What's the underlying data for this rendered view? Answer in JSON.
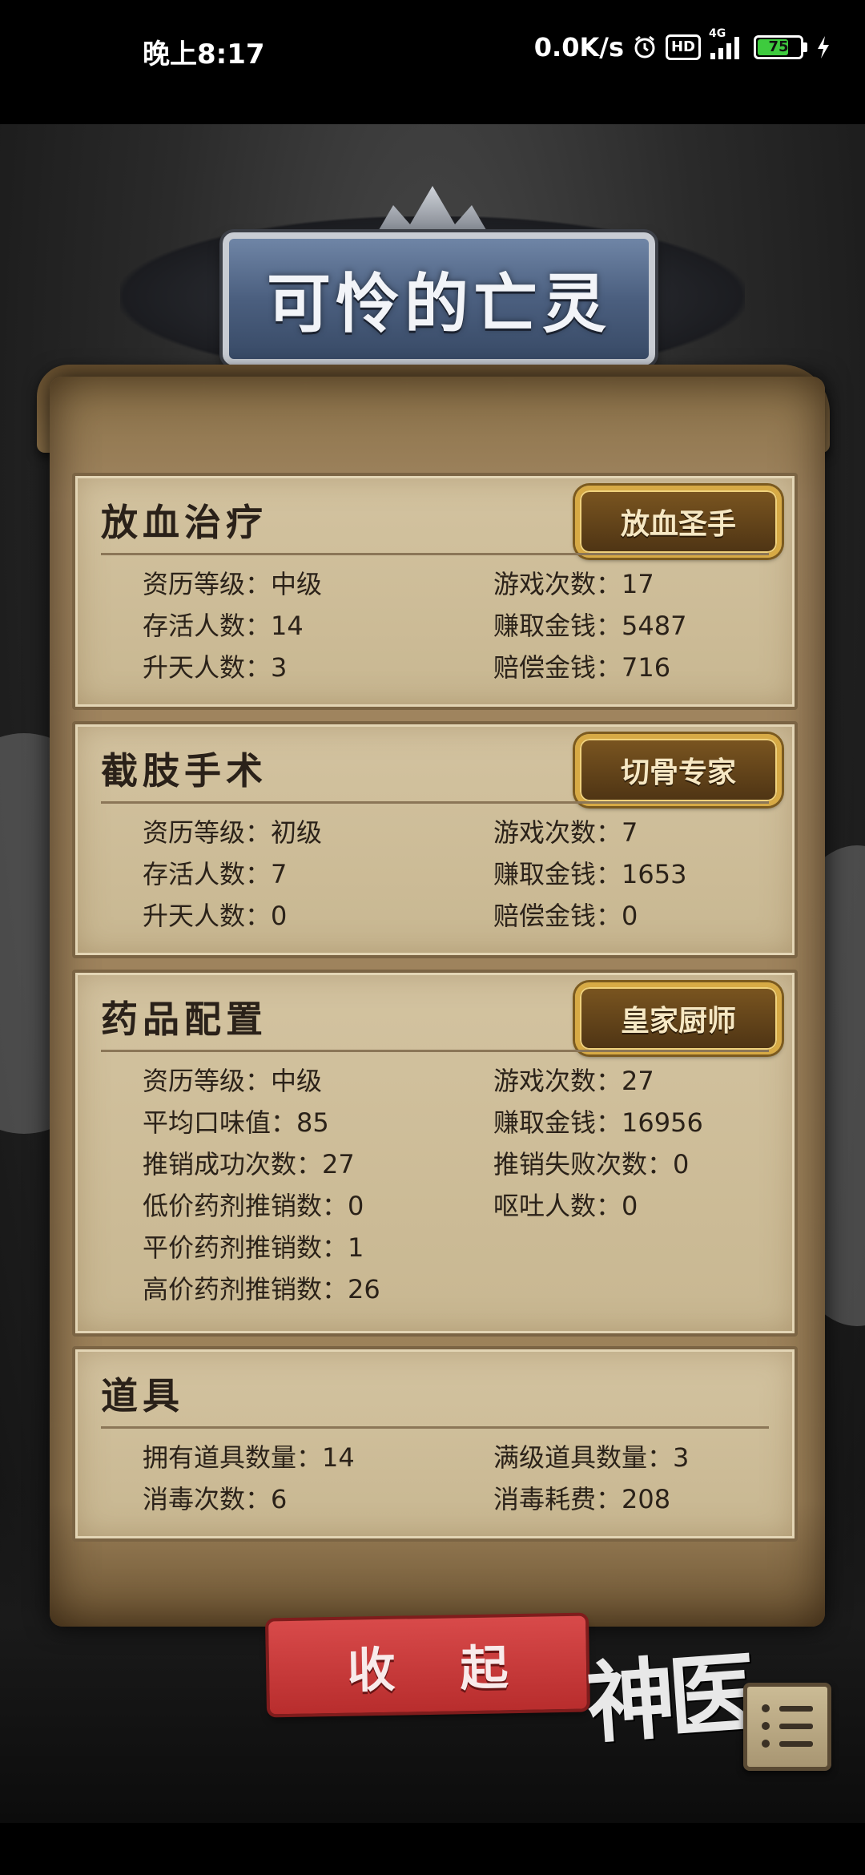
{
  "status_bar": {
    "time": "晚上8:17",
    "net_speed": "0.0K/s",
    "hd_label": "HD",
    "signal_label": "4G",
    "battery": "75",
    "battery_level": 0.75,
    "icons": [
      "alarm-icon",
      "hd-icon",
      "signal-icon",
      "battery-icon",
      "charging-icon"
    ]
  },
  "title": "可怜的亡灵",
  "sections": [
    {
      "title": "放血治疗",
      "badge": "放血圣手",
      "stats": [
        [
          "资历等级：中级",
          "游戏次数：17"
        ],
        [
          "存活人数：14",
          "赚取金钱：5487"
        ],
        [
          "升天人数：3",
          "赔偿金钱：716"
        ]
      ]
    },
    {
      "title": "截肢手术",
      "badge": "切骨专家",
      "stats": [
        [
          "资历等级：初级",
          "游戏次数：7"
        ],
        [
          "存活人数：7",
          "赚取金钱：1653"
        ],
        [
          "升天人数：0",
          "赔偿金钱：0"
        ]
      ]
    },
    {
      "title": "药品配置",
      "badge": "皇家厨师",
      "stats": [
        [
          "资历等级：中级",
          "游戏次数：27"
        ],
        [
          "平均口味值：85",
          "赚取金钱：16956"
        ],
        [
          "推销成功次数：27",
          "推销失败次数：0"
        ],
        [
          "低价药剂推销数：0",
          "呕吐人数：0"
        ],
        [
          "平价药剂推销数：1",
          ""
        ],
        [
          "高价药剂推销数：26",
          ""
        ]
      ]
    },
    {
      "title": "道具",
      "badge": "",
      "stats": [
        [
          "拥有道具数量：14",
          "满级道具数量：3"
        ],
        [
          "消毒次数：6",
          "消毒耗费：208"
        ]
      ]
    }
  ],
  "collapse_button": "收 起",
  "logo": "神医",
  "menu_icon": "list-menu-icon"
}
